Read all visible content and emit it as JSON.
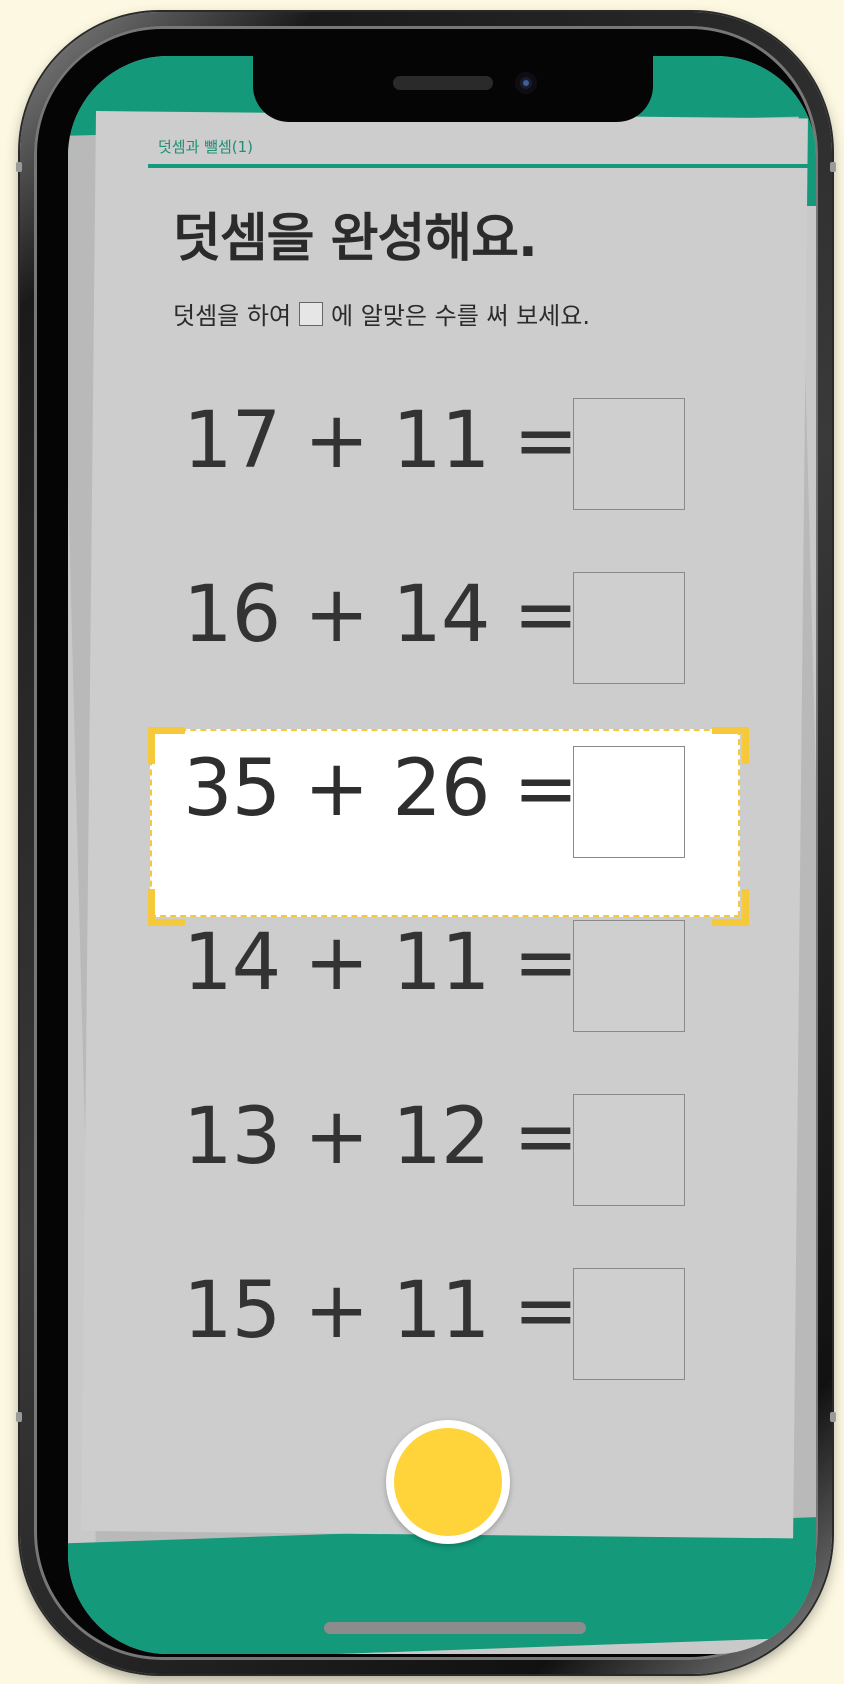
{
  "worksheet": {
    "breadcrumb": "덧셈과 뺄셈(1)",
    "title": "덧셈을 완성해요.",
    "instruction_before": "덧셈을 하여",
    "instruction_after": "에 알맞은 수를 써 보세요."
  },
  "problems": [
    {
      "expression": "17 + 11 =",
      "answer": ""
    },
    {
      "expression": "16 + 14 =",
      "answer": ""
    },
    {
      "expression": "35 + 26 =",
      "answer": "",
      "highlighted": true
    },
    {
      "expression": "14 + 11 =",
      "answer": ""
    },
    {
      "expression": "13 + 12 =",
      "answer": ""
    },
    {
      "expression": "15 + 11 =",
      "answer": ""
    }
  ],
  "colors": {
    "accent_green": "#14997a",
    "highlight_yellow": "#f6c93a",
    "shutter_yellow": "#ffd43a"
  },
  "icons": {
    "shutter": "camera-shutter-button"
  }
}
